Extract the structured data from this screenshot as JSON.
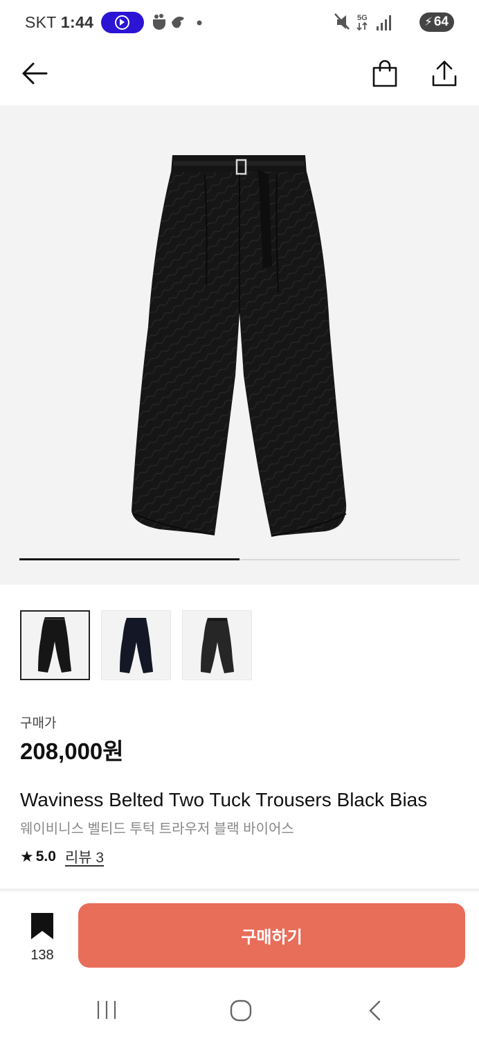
{
  "status_bar": {
    "carrier": "SKT",
    "time": "1:44",
    "network": "5G",
    "battery": "64"
  },
  "header": {
    "back_icon": "arrow-left-icon",
    "bag_icon": "shopping-bag-icon",
    "share_icon": "share-icon"
  },
  "hero": {
    "image": "black-belted-trousers-photo",
    "progress_fraction": 0.5
  },
  "thumbnails": [
    {
      "name": "black-bias-variant",
      "selected": true
    },
    {
      "name": "navy-variant",
      "selected": false
    },
    {
      "name": "charcoal-variant",
      "selected": false
    }
  ],
  "product": {
    "price_label": "구매가",
    "price": "208,000원",
    "title_en": "Waviness Belted Two Tuck Trousers Black Bias",
    "title_ko": "웨이비니스 벨티드 투턱 트라우저 블랙 바이어스",
    "rating_score": "5.0",
    "reviews_label": "리뷰 3"
  },
  "bottom_bar": {
    "bookmark_count": "138",
    "buy_label": "구매하기",
    "buy_color": "#e86e5a"
  },
  "nav_bar": {
    "recents_icon": "recents-icon",
    "home_icon": "home-icon",
    "back_icon": "nav-back-icon"
  }
}
